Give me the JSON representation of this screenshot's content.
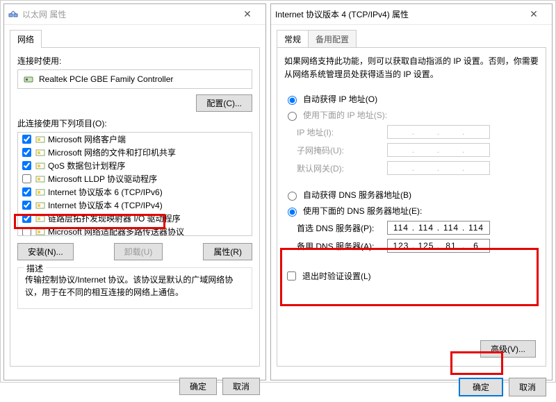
{
  "ethernet": {
    "title": "以太网 属性",
    "tab_network": "网络",
    "connect_using": "连接时使用:",
    "adapter": "Realtek PCIe GBE Family Controller",
    "configure_btn": "配置(C)...",
    "uses_following": "此连接使用下列项目(O):",
    "items": [
      {
        "checked": true,
        "label": "Microsoft 网络客户端"
      },
      {
        "checked": true,
        "label": "Microsoft 网络的文件和打印机共享"
      },
      {
        "checked": true,
        "label": "QoS 数据包计划程序"
      },
      {
        "checked": false,
        "label": "Microsoft LLDP 协议驱动程序"
      },
      {
        "checked": true,
        "label": "Internet 协议版本 6 (TCP/IPv6)"
      },
      {
        "checked": true,
        "label": "Internet 协议版本 4 (TCP/IPv4)"
      },
      {
        "checked": true,
        "label": "链路层拓扑发现映射器 I/O 驱动程序"
      },
      {
        "checked": false,
        "label": "Microsoft 网络适配器多路传送器协议"
      }
    ],
    "install_btn": "安装(N)...",
    "uninstall_btn": "卸载(U)",
    "properties_btn": "属性(R)",
    "desc_heading": "描述",
    "desc_text": "传输控制协议/Internet 协议。该协议是默认的广域网络协议，用于在不同的相互连接的网络上通信。",
    "ok": "确定",
    "cancel": "取消"
  },
  "ipv4": {
    "title": "Internet 协议版本 4 (TCP/IPv4) 属性",
    "tab_general": "常规",
    "tab_alt": "备用配置",
    "intro": "如果网络支持此功能，则可以获取自动指派的 IP 设置。否则，你需要从网络系统管理员处获得适当的 IP 设置。",
    "auto_ip": "自动获得 IP 地址(O)",
    "manual_ip": "使用下面的 IP 地址(S):",
    "ip_label": "IP 地址(I):",
    "subnet_label": "子网掩码(U):",
    "gateway_label": "默认网关(D):",
    "auto_dns": "自动获得 DNS 服务器地址(B)",
    "manual_dns": "使用下面的 DNS 服务器地址(E):",
    "pref_dns_label": "首选 DNS 服务器(P):",
    "alt_dns_label": "备用 DNS 服务器(A):",
    "pref_dns": [
      "114",
      "114",
      "114",
      "114"
    ],
    "alt_dns": [
      "123",
      "125",
      "81",
      "6"
    ],
    "validate": "退出时验证设置(L)",
    "advanced": "高级(V)...",
    "ok": "确定",
    "cancel": "取消"
  }
}
